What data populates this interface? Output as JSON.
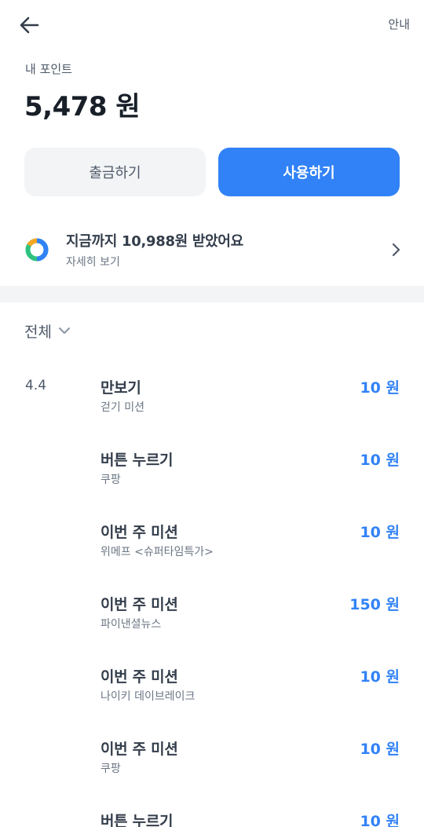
{
  "header": {
    "guide_label": "안내"
  },
  "points": {
    "label": "내 포인트",
    "value": "5,478 원"
  },
  "actions": {
    "withdraw_label": "출금하기",
    "use_label": "사용하기"
  },
  "summary": {
    "title": "지금까지 10,988원 받았어요",
    "subtitle": "자세히 보기"
  },
  "filter": {
    "label": "전체"
  },
  "transactions": {
    "date": "4.4",
    "items": [
      {
        "title": "만보기",
        "sub": "걷기 미션",
        "amount": "10 원"
      },
      {
        "title": "버튼 누르기",
        "sub": "쿠팡",
        "amount": "10 원"
      },
      {
        "title": "이번 주 미션",
        "sub": "위메프 <슈퍼타임특가>",
        "amount": "10 원"
      },
      {
        "title": "이번 주 미션",
        "sub": "파이낸셜뉴스",
        "amount": "150 원"
      },
      {
        "title": "이번 주 미션",
        "sub": "나이키 데이브레이크",
        "amount": "10 원"
      },
      {
        "title": "이번 주 미션",
        "sub": "쿠팡",
        "amount": "10 원"
      },
      {
        "title": "버튼 누르기",
        "sub": "",
        "amount": "10 원"
      }
    ]
  },
  "colors": {
    "accent": "#3182f6",
    "donut": [
      "#3182f6",
      "#f5a623",
      "#2ec27e"
    ]
  },
  "icons": {
    "back": "arrow-left-icon",
    "donut": "donut-chart-icon",
    "chevron_right": "chevron-right-icon",
    "chevron_down": "chevron-down-icon"
  }
}
